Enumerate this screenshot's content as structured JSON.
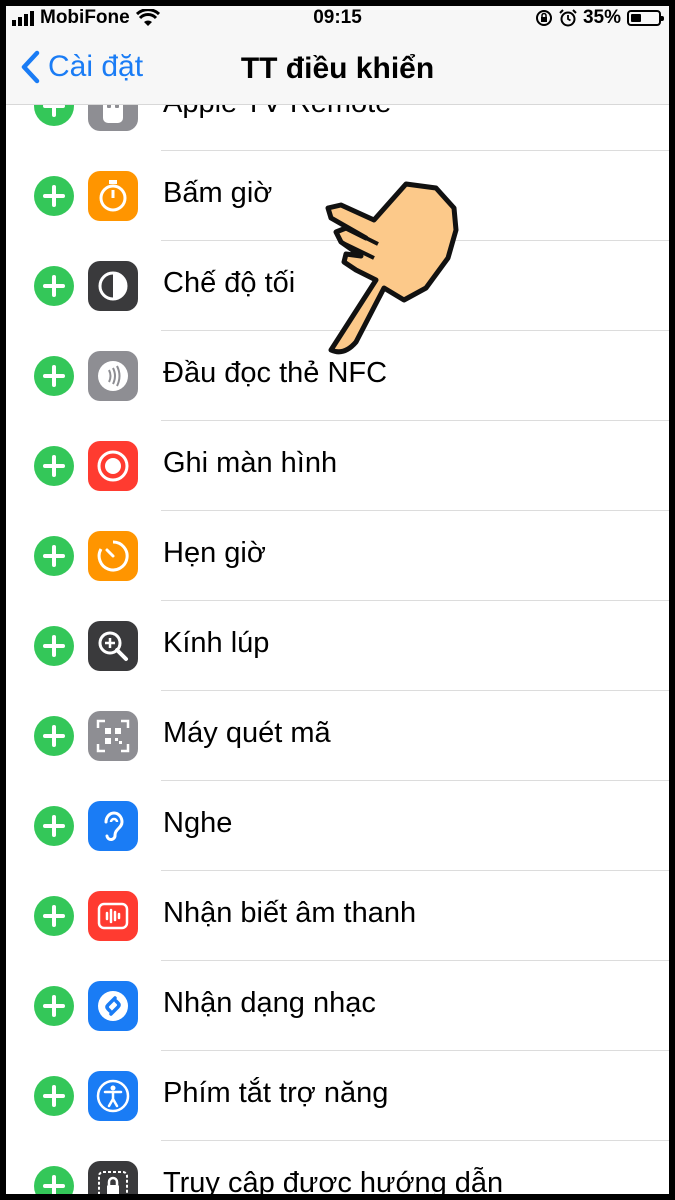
{
  "status_bar": {
    "carrier": "MobiFone",
    "time": "09:15",
    "battery": "35%"
  },
  "nav": {
    "back_label": "Cài đặt",
    "title": "TT điều khiển"
  },
  "items": [
    {
      "label": "Apple TV Remote",
      "icon": "apple-tv-remote-icon",
      "color": "#8e8e93"
    },
    {
      "label": "Bấm giờ",
      "icon": "stopwatch-icon",
      "color": "#ff9500"
    },
    {
      "label": "Chế độ tối",
      "icon": "dark-mode-icon",
      "color": "#3a3a3c"
    },
    {
      "label": "Đầu đọc thẻ NFC",
      "icon": "nfc-icon",
      "color": "#8e8e93"
    },
    {
      "label": "Ghi màn hình",
      "icon": "screen-record-icon",
      "color": "#ff3b30"
    },
    {
      "label": "Hẹn giờ",
      "icon": "timer-icon",
      "color": "#ff9500"
    },
    {
      "label": "Kính lúp",
      "icon": "magnifier-icon",
      "color": "#3a3a3c"
    },
    {
      "label": "Máy quét mã",
      "icon": "code-scanner-icon",
      "color": "#8e8e93"
    },
    {
      "label": "Nghe",
      "icon": "hearing-icon",
      "color": "#1a7cf5"
    },
    {
      "label": "Nhận biết âm thanh",
      "icon": "sound-recognition-icon",
      "color": "#ff3b30"
    },
    {
      "label": "Nhận dạng nhạc",
      "icon": "shazam-icon",
      "color": "#1a7cf5"
    },
    {
      "label": "Phím tắt trợ năng",
      "icon": "accessibility-icon",
      "color": "#1a7cf5"
    },
    {
      "label": "Truy cập được hướng dẫn",
      "icon": "guided-access-icon",
      "color": "#3a3a3c"
    }
  ]
}
